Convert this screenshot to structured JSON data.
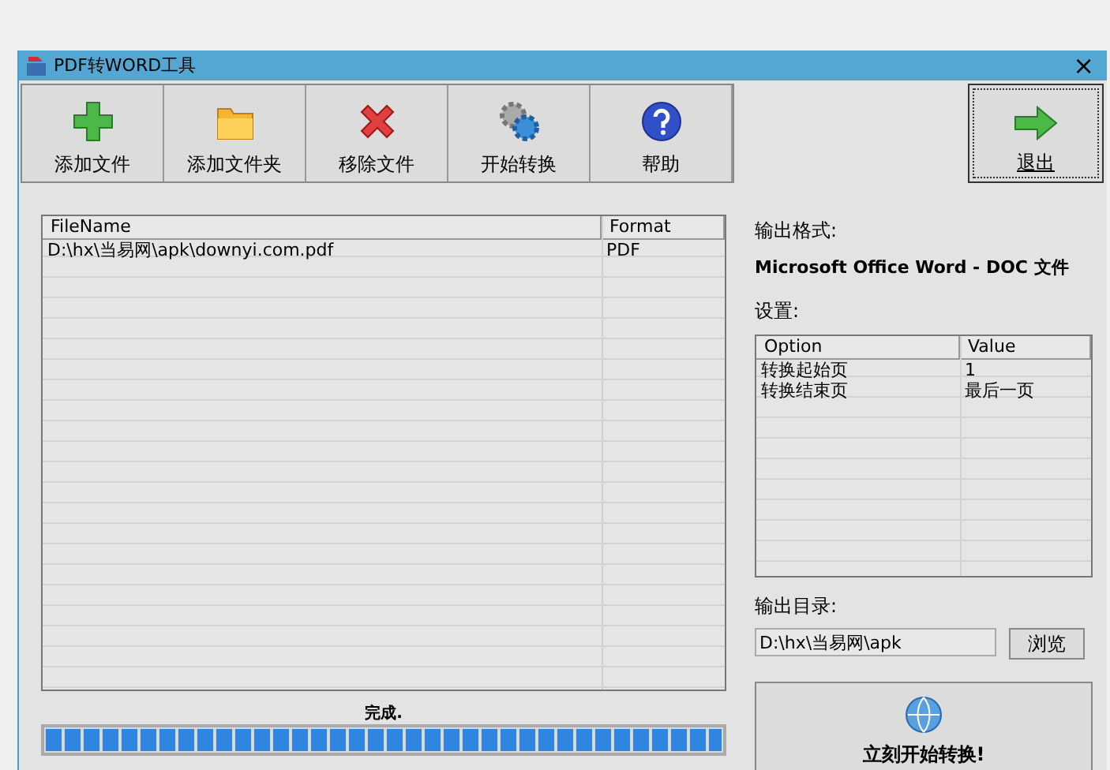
{
  "window": {
    "title": "PDF转WORD工具",
    "close": "×"
  },
  "toolbar": [
    {
      "label": "添加文件"
    },
    {
      "label": "添加文件夹"
    },
    {
      "label": "移除文件"
    },
    {
      "label": "开始转换"
    },
    {
      "label": "帮助"
    }
  ],
  "exit_button": {
    "label": "退出"
  },
  "file_table": {
    "columns": [
      "FileName",
      "Format"
    ],
    "rows": [
      [
        "D:\\hx\\当易网\\apk\\downyi.com.pdf",
        "PDF"
      ]
    ]
  },
  "status": {
    "text": "完成.",
    "level": 1
  },
  "output_format": {
    "label": "输出格式:",
    "value": "Microsoft Office Word - DOC 文件"
  },
  "settings": {
    "label": "设置:",
    "columns": [
      "Option",
      "Value"
    ],
    "rows": [
      [
        "转换起始页",
        "1"
      ],
      [
        "转换结束页",
        "最后一页"
      ]
    ]
  },
  "output_dir": {
    "label": "输出目录:",
    "value": "D:\\hx\\当易网\\apk",
    "browse": "浏览"
  },
  "start_button": {
    "label": "立刻开始转换!"
  }
}
